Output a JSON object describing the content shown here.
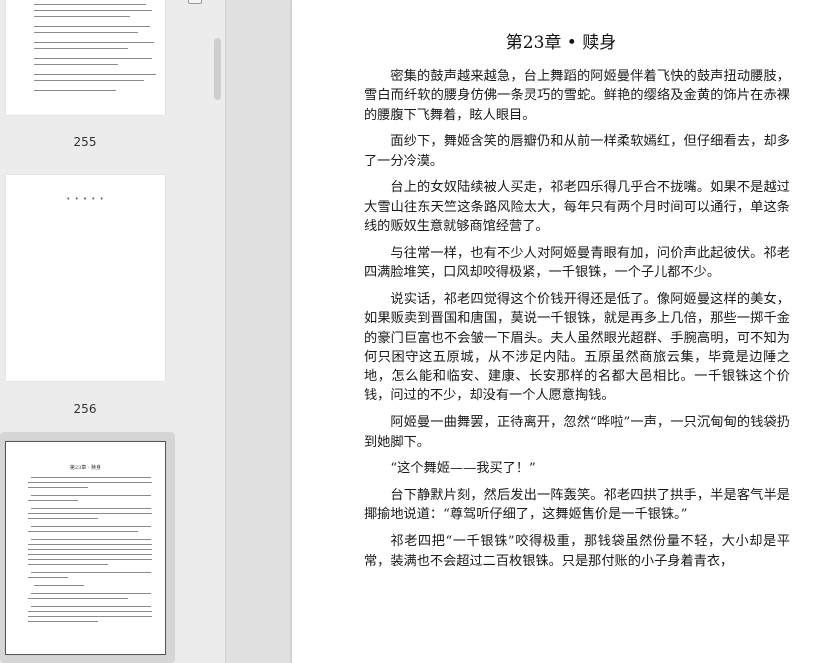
{
  "thumbnails": [
    {
      "page_label": "255"
    },
    {
      "page_label": "256",
      "content": "• • • • •"
    },
    {
      "page_label": "",
      "mini_title": "第23章 · 赎身"
    }
  ],
  "document": {
    "chapter_title": "第23章 • 赎身",
    "paragraphs": [
      "密集的鼓声越来越急，台上舞蹈的阿姬曼伴着飞快的鼓声扭动腰肢，雪白而纤软的腰身仿佛一条灵巧的雪蛇。鲜艳的缨络及金黄的饰片在赤裸的腰腹下飞舞着，眩人眼目。",
      "面纱下，舞姬含笑的唇瓣仍和从前一样柔软嫣红，但仔细看去，却多了一分冷漠。",
      "台上的女奴陆续被人买走，祁老四乐得几乎合不拢嘴。如果不是越过大雪山往东天竺这条路风险太大，每年只有两个月时间可以通行，单这条线的贩奴生意就够商馆经营了。",
      "与往常一样，也有不少人对阿姬曼青眼有加，问价声此起彼伏。祁老四满脸堆笑，口风却咬得极紧，一千银铢，一个子儿都不少。",
      "说实话，祁老四觉得这个价钱开得还是低了。像阿姬曼这样的美女，如果贩卖到晋国和唐国，莫说一千银铢，就是再多上几倍，那些一掷千金的豪门巨富也不会皱一下眉头。夫人虽然眼光超群、手腕高明，可不知为何只困守这五原城，从不涉足内陆。五原虽然商旅云集，毕竟是边陲之地，怎么能和临安、建康、长安那样的名都大邑相比。一千银铢这个价钱，问过的不少，却没有一个人愿意掏钱。",
      "阿姬曼一曲舞罢，正待离开，忽然“哗啦”一声，一只沉甸甸的钱袋扔到她脚下。",
      "“这个舞姬——我买了！”",
      "台下静默片刻，然后发出一阵轰笑。祁老四拱了拱手，半是客气半是揶揄地说道：“尊驾听仔细了，这舞姬售价是一千银铢。”",
      "祁老四把“一千银铢”咬得极重，那钱袋虽然份量不轻，大小却是平常，装满也不会超过二百枚银铢。只是那付账的小子身着青衣，"
    ]
  }
}
